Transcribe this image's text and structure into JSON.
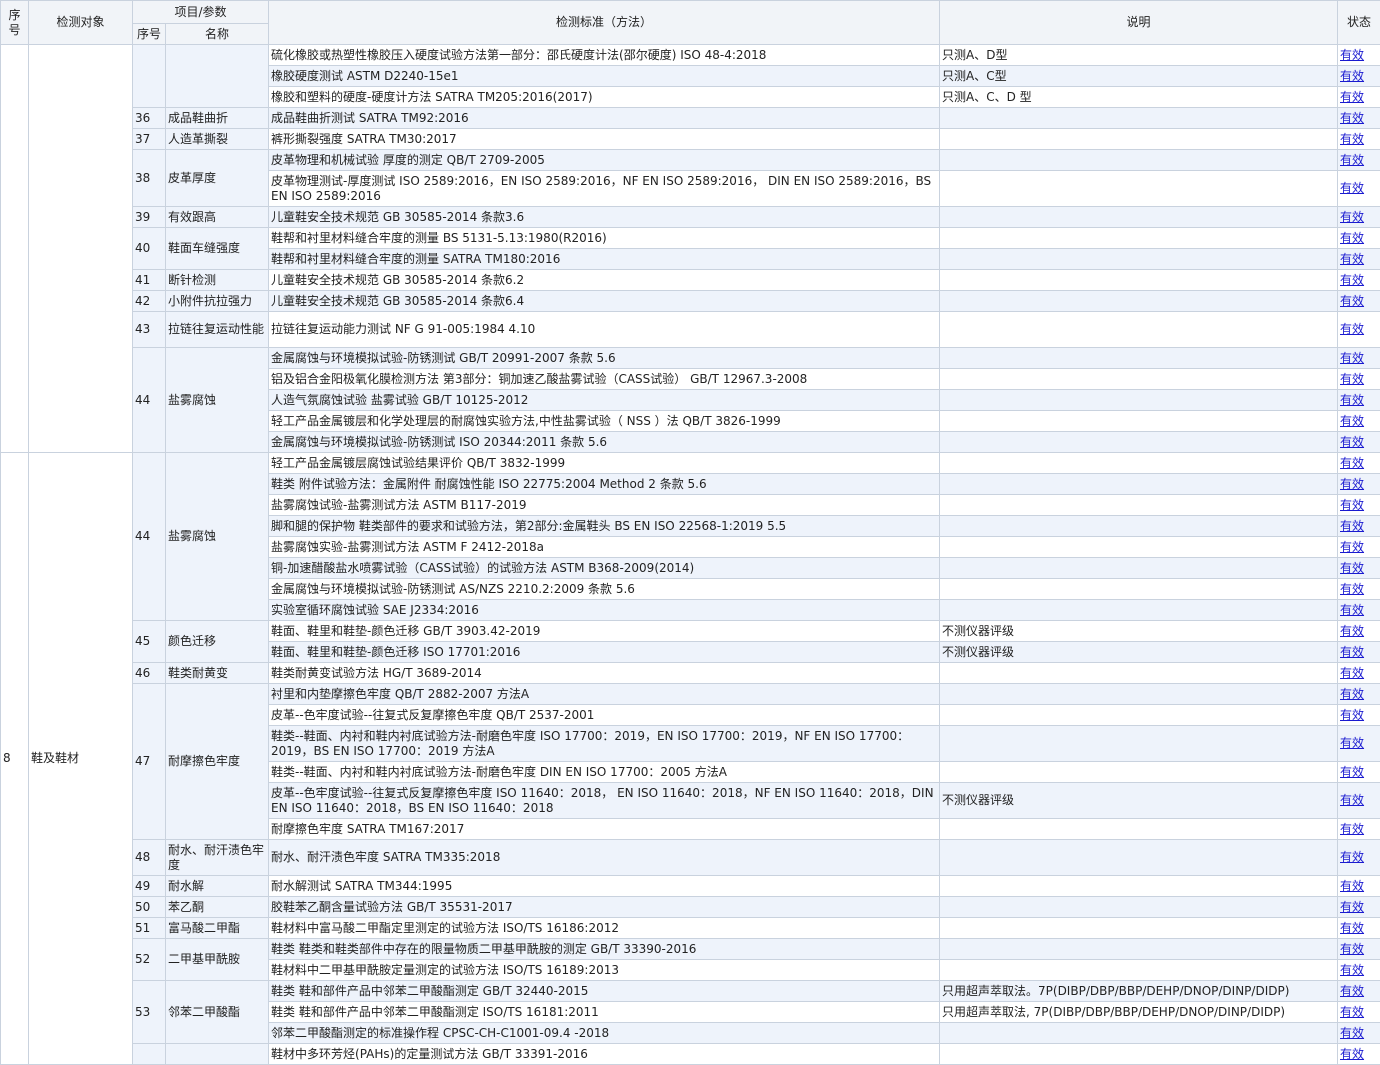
{
  "header": {
    "seq": "序号",
    "object": "检测对象",
    "item_param": "项目/参数",
    "sub_seq": "序号",
    "sub_name": "名称",
    "standard": "检测标准（方法）",
    "note": "说明",
    "status": "状态"
  },
  "group": {
    "seq": "8",
    "object": "鞋及鞋材"
  },
  "rows": [
    {
      "code": "",
      "name": "",
      "standard": "硫化橡胶或热塑性橡胶压入硬度试验方法第一部分：邵氏硬度计法(邵尔硬度) ISO 48-4:2018",
      "note": "只测A、D型",
      "status": "有效"
    },
    {
      "code": "",
      "name": "",
      "standard": "橡胶硬度测试 ASTM D2240-15e1",
      "note": "只测A、C型",
      "status": "有效"
    },
    {
      "code": "",
      "name": "",
      "standard": "橡胶和塑料的硬度-硬度计方法 SATRA TM205:2016(2017)",
      "note": "只测A、C、D 型",
      "status": "有效"
    },
    {
      "code": "36",
      "name": "成品鞋曲折",
      "standard": "成品鞋曲折测试 SATRA TM92:2016",
      "note": "",
      "status": "有效"
    },
    {
      "code": "37",
      "name": "人造革撕裂",
      "standard": "裤形撕裂强度 SATRA TM30:2017",
      "note": "",
      "status": "有效"
    },
    {
      "code": "38",
      "name": "皮革厚度",
      "standard": "皮革物理和机械试验 厚度的测定 QB/T 2709-2005",
      "note": "",
      "status": "有效"
    },
    {
      "code": "",
      "name": "",
      "standard": "皮革物理测试-厚度测试 ISO 2589:2016，EN ISO 2589:2016，NF EN ISO 2589:2016， DIN EN ISO 2589:2016，BS EN ISO 2589:2016",
      "note": "",
      "status": "有效"
    },
    {
      "code": "39",
      "name": "有效跟高",
      "standard": "儿童鞋安全技术规范 GB 30585-2014 条款3.6",
      "note": "",
      "status": "有效"
    },
    {
      "code": "40",
      "name": "鞋面车缝强度",
      "standard": "鞋帮和衬里材料缝合牢度的测量 BS 5131-5.13:1980(R2016)",
      "note": "",
      "status": "有效"
    },
    {
      "code": "",
      "name": "",
      "standard": "鞋帮和衬里材料缝合牢度的测量 SATRA TM180:2016",
      "note": "",
      "status": "有效"
    },
    {
      "code": "41",
      "name": "断针检测",
      "standard": "儿童鞋安全技术规范 GB 30585-2014 条款6.2",
      "note": "",
      "status": "有效"
    },
    {
      "code": "42",
      "name": "小附件抗拉强力",
      "standard": "儿童鞋安全技术规范 GB 30585-2014 条款6.4",
      "note": "",
      "status": "有效"
    },
    {
      "code": "43",
      "name": "拉链往复运动性能",
      "standard": "拉链往复运动能力测试 NF G 91-005:1984 4.10",
      "note": "",
      "status": "有效"
    },
    {
      "code": "44",
      "name": "盐雾腐蚀",
      "standard": "金属腐蚀与环境模拟试验-防锈测试 GB/T 20991-2007 条款 5.6",
      "note": "",
      "status": "有效"
    },
    {
      "code": "",
      "name": "",
      "standard": "铝及铝合金阳极氧化膜检测方法 第3部分：铜加速乙酸盐雾试验（CASS试验） GB/T 12967.3-2008",
      "note": "",
      "status": "有效"
    },
    {
      "code": "",
      "name": "",
      "standard": "人造气氛腐蚀试验 盐雾试验 GB/T 10125-2012",
      "note": "",
      "status": "有效"
    },
    {
      "code": "",
      "name": "",
      "standard": "轻工产品金属镀层和化学处理层的耐腐蚀实验方法,中性盐雾试验（ NSS ）法 QB/T 3826-1999",
      "note": "",
      "status": "有效"
    },
    {
      "code": "",
      "name": "",
      "standard": "金属腐蚀与环境模拟试验-防锈测试 ISO 20344:2011 条款 5.6",
      "note": "",
      "status": "有效"
    },
    {
      "code": "44",
      "name": "盐雾腐蚀",
      "standard": "轻工产品金属镀层腐蚀试验结果评价 QB/T 3832-1999",
      "note": "",
      "status": "有效"
    },
    {
      "code": "",
      "name": "",
      "standard": "鞋类 附件试验方法：金属附件 耐腐蚀性能 ISO 22775:2004 Method 2 条款 5.6",
      "note": "",
      "status": "有效"
    },
    {
      "code": "",
      "name": "",
      "standard": "盐雾腐蚀试验-盐雾测试方法 ASTM B117-2019",
      "note": "",
      "status": "有效"
    },
    {
      "code": "",
      "name": "",
      "standard": "脚和腿的保护物 鞋类部件的要求和试验方法，第2部分:金属鞋头 BS EN ISO 22568-1:2019 5.5",
      "note": "",
      "status": "有效"
    },
    {
      "code": "",
      "name": "",
      "standard": "盐雾腐蚀实验-盐雾测试方法 ASTM F 2412-2018a",
      "note": "",
      "status": "有效"
    },
    {
      "code": "",
      "name": "",
      "standard": "铜-加速醋酸盐水喷雾试验（CASS试验）的试验方法 ASTM B368-2009(2014)",
      "note": "",
      "status": "有效"
    },
    {
      "code": "",
      "name": "",
      "standard": "金属腐蚀与环境模拟试验-防锈测试 AS/NZS 2210.2:2009 条款 5.6",
      "note": "",
      "status": "有效"
    },
    {
      "code": "",
      "name": "",
      "standard": "实验室循环腐蚀试验 SAE J2334:2016",
      "note": "",
      "status": "有效"
    },
    {
      "code": "45",
      "name": "颜色迁移",
      "standard": "鞋面、鞋里和鞋垫-颜色迁移 GB/T 3903.42-2019",
      "note": "不测仪器评级",
      "status": "有效"
    },
    {
      "code": "",
      "name": "",
      "standard": "鞋面、鞋里和鞋垫-颜色迁移 ISO 17701:2016",
      "note": "不测仪器评级",
      "status": "有效"
    },
    {
      "code": "46",
      "name": "鞋类耐黄变",
      "standard": "鞋类耐黄变试验方法 HG/T 3689-2014",
      "note": "",
      "status": "有效"
    },
    {
      "code": "47",
      "name": "耐摩擦色牢度",
      "standard": "衬里和内垫摩擦色牢度 QB/T 2882-2007 方法A",
      "note": "",
      "status": "有效"
    },
    {
      "code": "",
      "name": "",
      "standard": "皮革--色牢度试验--往复式反复摩擦色牢度 QB/T 2537-2001",
      "note": "",
      "status": "有效"
    },
    {
      "code": "",
      "name": "",
      "standard": "鞋类--鞋面、内衬和鞋内衬底试验方法-耐磨色牢度 ISO 17700：2019，EN ISO 17700：2019，NF EN ISO 17700：2019，BS EN ISO 17700：2019 方法A",
      "note": "",
      "status": "有效"
    },
    {
      "code": "",
      "name": "",
      "standard": "鞋类--鞋面、内衬和鞋内衬底试验方法-耐磨色牢度 DIN EN ISO 17700：2005 方法A",
      "note": "",
      "status": "有效"
    },
    {
      "code": "",
      "name": "",
      "standard": "皮革--色牢度试验--往复式反复摩擦色牢度 ISO 11640：2018， EN ISO 11640：2018，NF EN ISO 11640：2018，DIN EN ISO 11640：2018，BS EN ISO 11640：2018",
      "note": "不测仪器评级",
      "status": "有效"
    },
    {
      "code": "",
      "name": "",
      "standard": "耐摩擦色牢度 SATRA TM167:2017",
      "note": "",
      "status": "有效"
    },
    {
      "code": "48",
      "name": "耐水、耐汗渍色牢度",
      "standard": "耐水、耐汗渍色牢度 SATRA TM335:2018",
      "note": "",
      "status": "有效"
    },
    {
      "code": "49",
      "name": "耐水解",
      "standard": "耐水解测试 SATRA TM344:1995",
      "note": "",
      "status": "有效"
    },
    {
      "code": "50",
      "name": "苯乙酮",
      "standard": "胶鞋苯乙酮含量试验方法 GB/T 35531-2017",
      "note": "",
      "status": "有效"
    },
    {
      "code": "51",
      "name": "富马酸二甲酯",
      "standard": "鞋材料中富马酸二甲酯定里测定的试验方法 ISO/TS 16186:2012",
      "note": "",
      "status": "有效"
    },
    {
      "code": "52",
      "name": "二甲基甲酰胺",
      "standard": "鞋类 鞋类和鞋类部件中存在的限量物质二甲基甲酰胺的测定 GB/T 33390-2016",
      "note": "",
      "status": "有效"
    },
    {
      "code": "",
      "name": "",
      "standard": "鞋材料中二甲基甲酰胺定量测定的试验方法 ISO/TS 16189:2013",
      "note": "",
      "status": "有效"
    },
    {
      "code": "53",
      "name": "邻苯二甲酸酯",
      "standard": "鞋类 鞋和部件产品中邻苯二甲酸酯测定 GB/T 32440-2015",
      "note": "只用超声萃取法。7P(DIBP/DBP/BBP/DEHP/DNOP/DINP/DIDP)",
      "status": "有效"
    },
    {
      "code": "",
      "name": "",
      "standard": "鞋类 鞋和部件产品中邻苯二甲酸酯测定 ISO/TS 16181:2011",
      "note": "只用超声萃取法, 7P(DIBP/DBP/BBP/DEHP/DNOP/DINP/DIDP)",
      "status": "有效"
    },
    {
      "code": "",
      "name": "",
      "standard": "邻苯二甲酸酯测定的标准操作程 CPSC-CH-C1001-09.4 -2018",
      "note": "",
      "status": "有效"
    },
    {
      "code": "",
      "name": "",
      "standard": "鞋材中多环芳烃(PAHs)的定量测试方法 GB/T 33391-2016",
      "note": "",
      "status": "有效"
    }
  ]
}
